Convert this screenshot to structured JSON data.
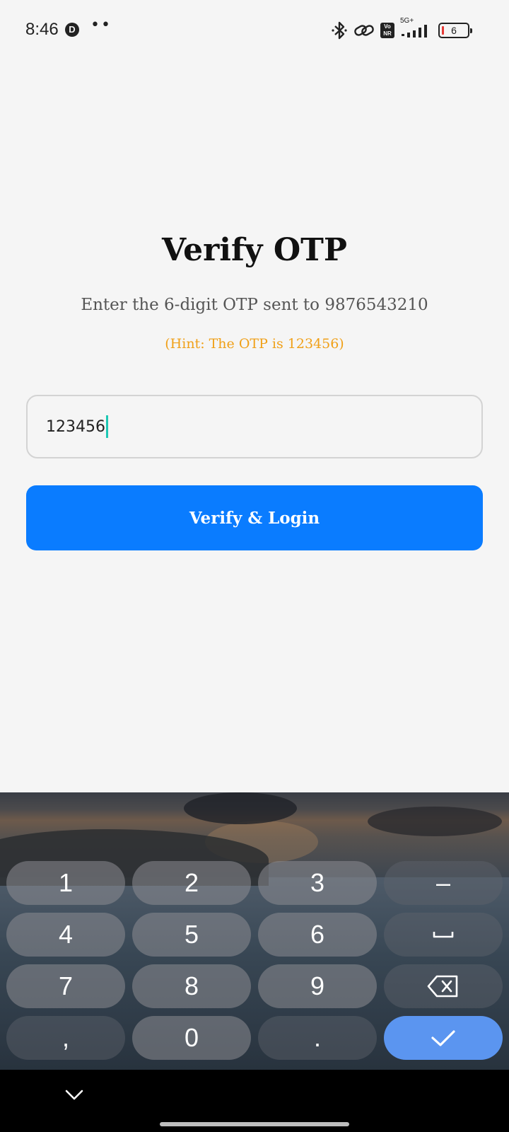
{
  "status_bar": {
    "time": "8:46",
    "app_badge": "D",
    "dots": "••",
    "volte_label": "Vo NR",
    "network_label": "5G+",
    "battery_level": "6",
    "icons": [
      "bluetooth-icon",
      "link-icon",
      "volte-icon",
      "signal-icon",
      "battery-icon"
    ]
  },
  "main": {
    "title": "Verify OTP",
    "subtitle": "Enter the 6-digit OTP sent to 9876543210",
    "hint": "(Hint: The OTP is 123456)",
    "otp_input": {
      "value": "123456",
      "placeholder": ""
    },
    "verify_button_label": "Verify & Login"
  },
  "keyboard": {
    "rows": [
      [
        "1",
        "2",
        "3",
        "-"
      ],
      [
        "4",
        "5",
        "6",
        "space"
      ],
      [
        "7",
        "8",
        "9",
        "backspace"
      ],
      [
        ",",
        "0",
        ".",
        "enter"
      ]
    ],
    "key_labels": {
      "k1": "1",
      "k2": "2",
      "k3": "3",
      "dash": "–",
      "k4": "4",
      "k5": "5",
      "k6": "6",
      "k7": "7",
      "k8": "8",
      "k9": "9",
      "comma": ",",
      "k0": "0",
      "period": "."
    }
  },
  "colors": {
    "primary_button": "#0a7cff",
    "hint_text": "#f0a018",
    "caret": "#1ec8b4",
    "enter_key": "#5b95f0"
  }
}
